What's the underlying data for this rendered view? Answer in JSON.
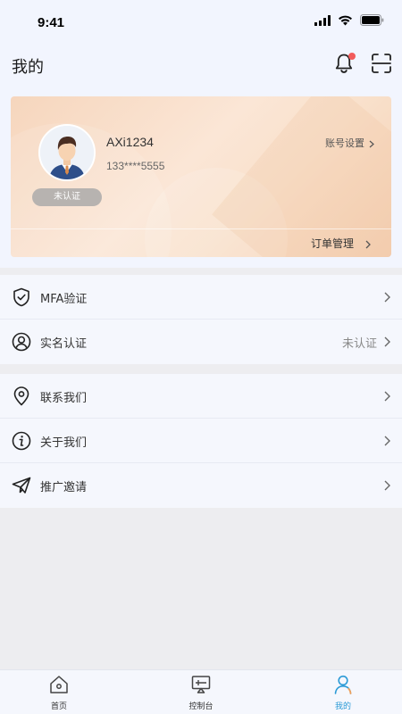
{
  "status_bar": {
    "time": "9:41"
  },
  "header": {
    "title": "我的"
  },
  "profile": {
    "username": "AXi1234",
    "phone": "133****5555",
    "verify_status": "未认证",
    "account_settings": "账号设置",
    "order_management": "订单管理"
  },
  "menu_group_1": [
    {
      "label": "MFA验证",
      "value": ""
    },
    {
      "label": "实名认证",
      "value": "未认证"
    }
  ],
  "menu_group_2": [
    {
      "label": "联系我们",
      "value": ""
    },
    {
      "label": "关于我们",
      "value": ""
    },
    {
      "label": "推广邀请",
      "value": ""
    }
  ],
  "tabbar": [
    {
      "label": "首页",
      "icon": "home-icon",
      "active": false
    },
    {
      "label": "控制台",
      "icon": "console-icon",
      "active": false
    },
    {
      "label": "我的",
      "icon": "user-icon",
      "active": true
    }
  ],
  "colors": {
    "accent": "#2a9ad6",
    "badge": "#f25b5b",
    "card_gradient_start": "#f6d6bd",
    "card_gradient_end": "#f4cfb2"
  }
}
